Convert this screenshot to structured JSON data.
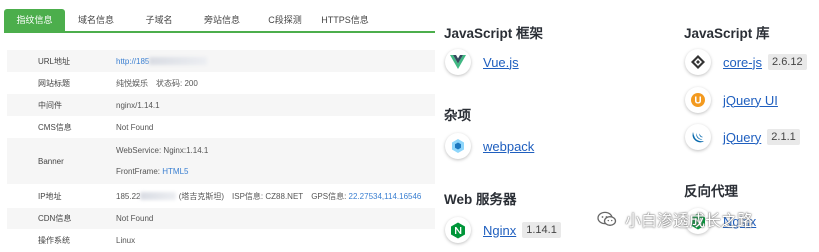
{
  "tabs": [
    "指纹信息",
    "域名信息",
    "子域名",
    "旁站信息",
    "C段探测",
    "HTTPS信息"
  ],
  "fingerprint": {
    "url": {
      "label": "URL地址",
      "value": "http://185"
    },
    "title": {
      "label": "网站标题",
      "value": "纯悦娱乐",
      "status_label": "状态码:",
      "status": "200"
    },
    "middleware": {
      "label": "中间件",
      "value": "nginx/1.14.1"
    },
    "cms": {
      "label": "CMS信息",
      "value": "Not Found"
    },
    "banner": {
      "label": "Banner",
      "line1": "WebService: Nginx:1.14.1",
      "line2_prefix": "FrontFrame:",
      "line2_link": "HTML5"
    },
    "ip": {
      "label": "IP地址",
      "prefix": "185.22",
      "location": "(塔吉克斯坦)",
      "isp_label": "ISP信息:",
      "isp": "CZ88.NET",
      "gps_label": "GPS信息:",
      "gps": "22.27534,114.16546"
    },
    "cdn": {
      "label": "CDN信息",
      "value": "Not Found"
    },
    "os": {
      "label": "操作系统",
      "value": "Linux"
    }
  },
  "tech": {
    "js_frameworks": {
      "title": "JavaScript 框架",
      "items": [
        {
          "name": "Vue.js",
          "icon": "vue-icon"
        }
      ]
    },
    "misc": {
      "title": "杂项",
      "items": [
        {
          "name": "webpack",
          "icon": "webpack-icon"
        }
      ]
    },
    "web_servers": {
      "title": "Web 服务器",
      "items": [
        {
          "name": "Nginx",
          "version": "1.14.1",
          "icon": "nginx-icon"
        }
      ]
    },
    "js_libraries": {
      "title": "JavaScript 库",
      "items": [
        {
          "name": "core-js",
          "version": "2.6.12",
          "icon": "core-js-icon"
        },
        {
          "name": "jQuery UI",
          "icon": "jquery-ui-icon"
        },
        {
          "name": "jQuery",
          "version": "2.1.1",
          "icon": "jquery-icon"
        }
      ]
    },
    "reverse_proxy": {
      "title": "反向代理",
      "items": [
        {
          "name": "Nginx",
          "icon": "nginx-icon"
        }
      ]
    }
  },
  "watermark": "小白渗透成长之路",
  "colors": {
    "tab_active": "#4cae4c",
    "link": "#1f5fbf",
    "vue_green": "#41b883",
    "nginx_green": "#009639",
    "jquery_blue": "#0769ad",
    "jquery_ui_orange": "#f39a1f"
  }
}
